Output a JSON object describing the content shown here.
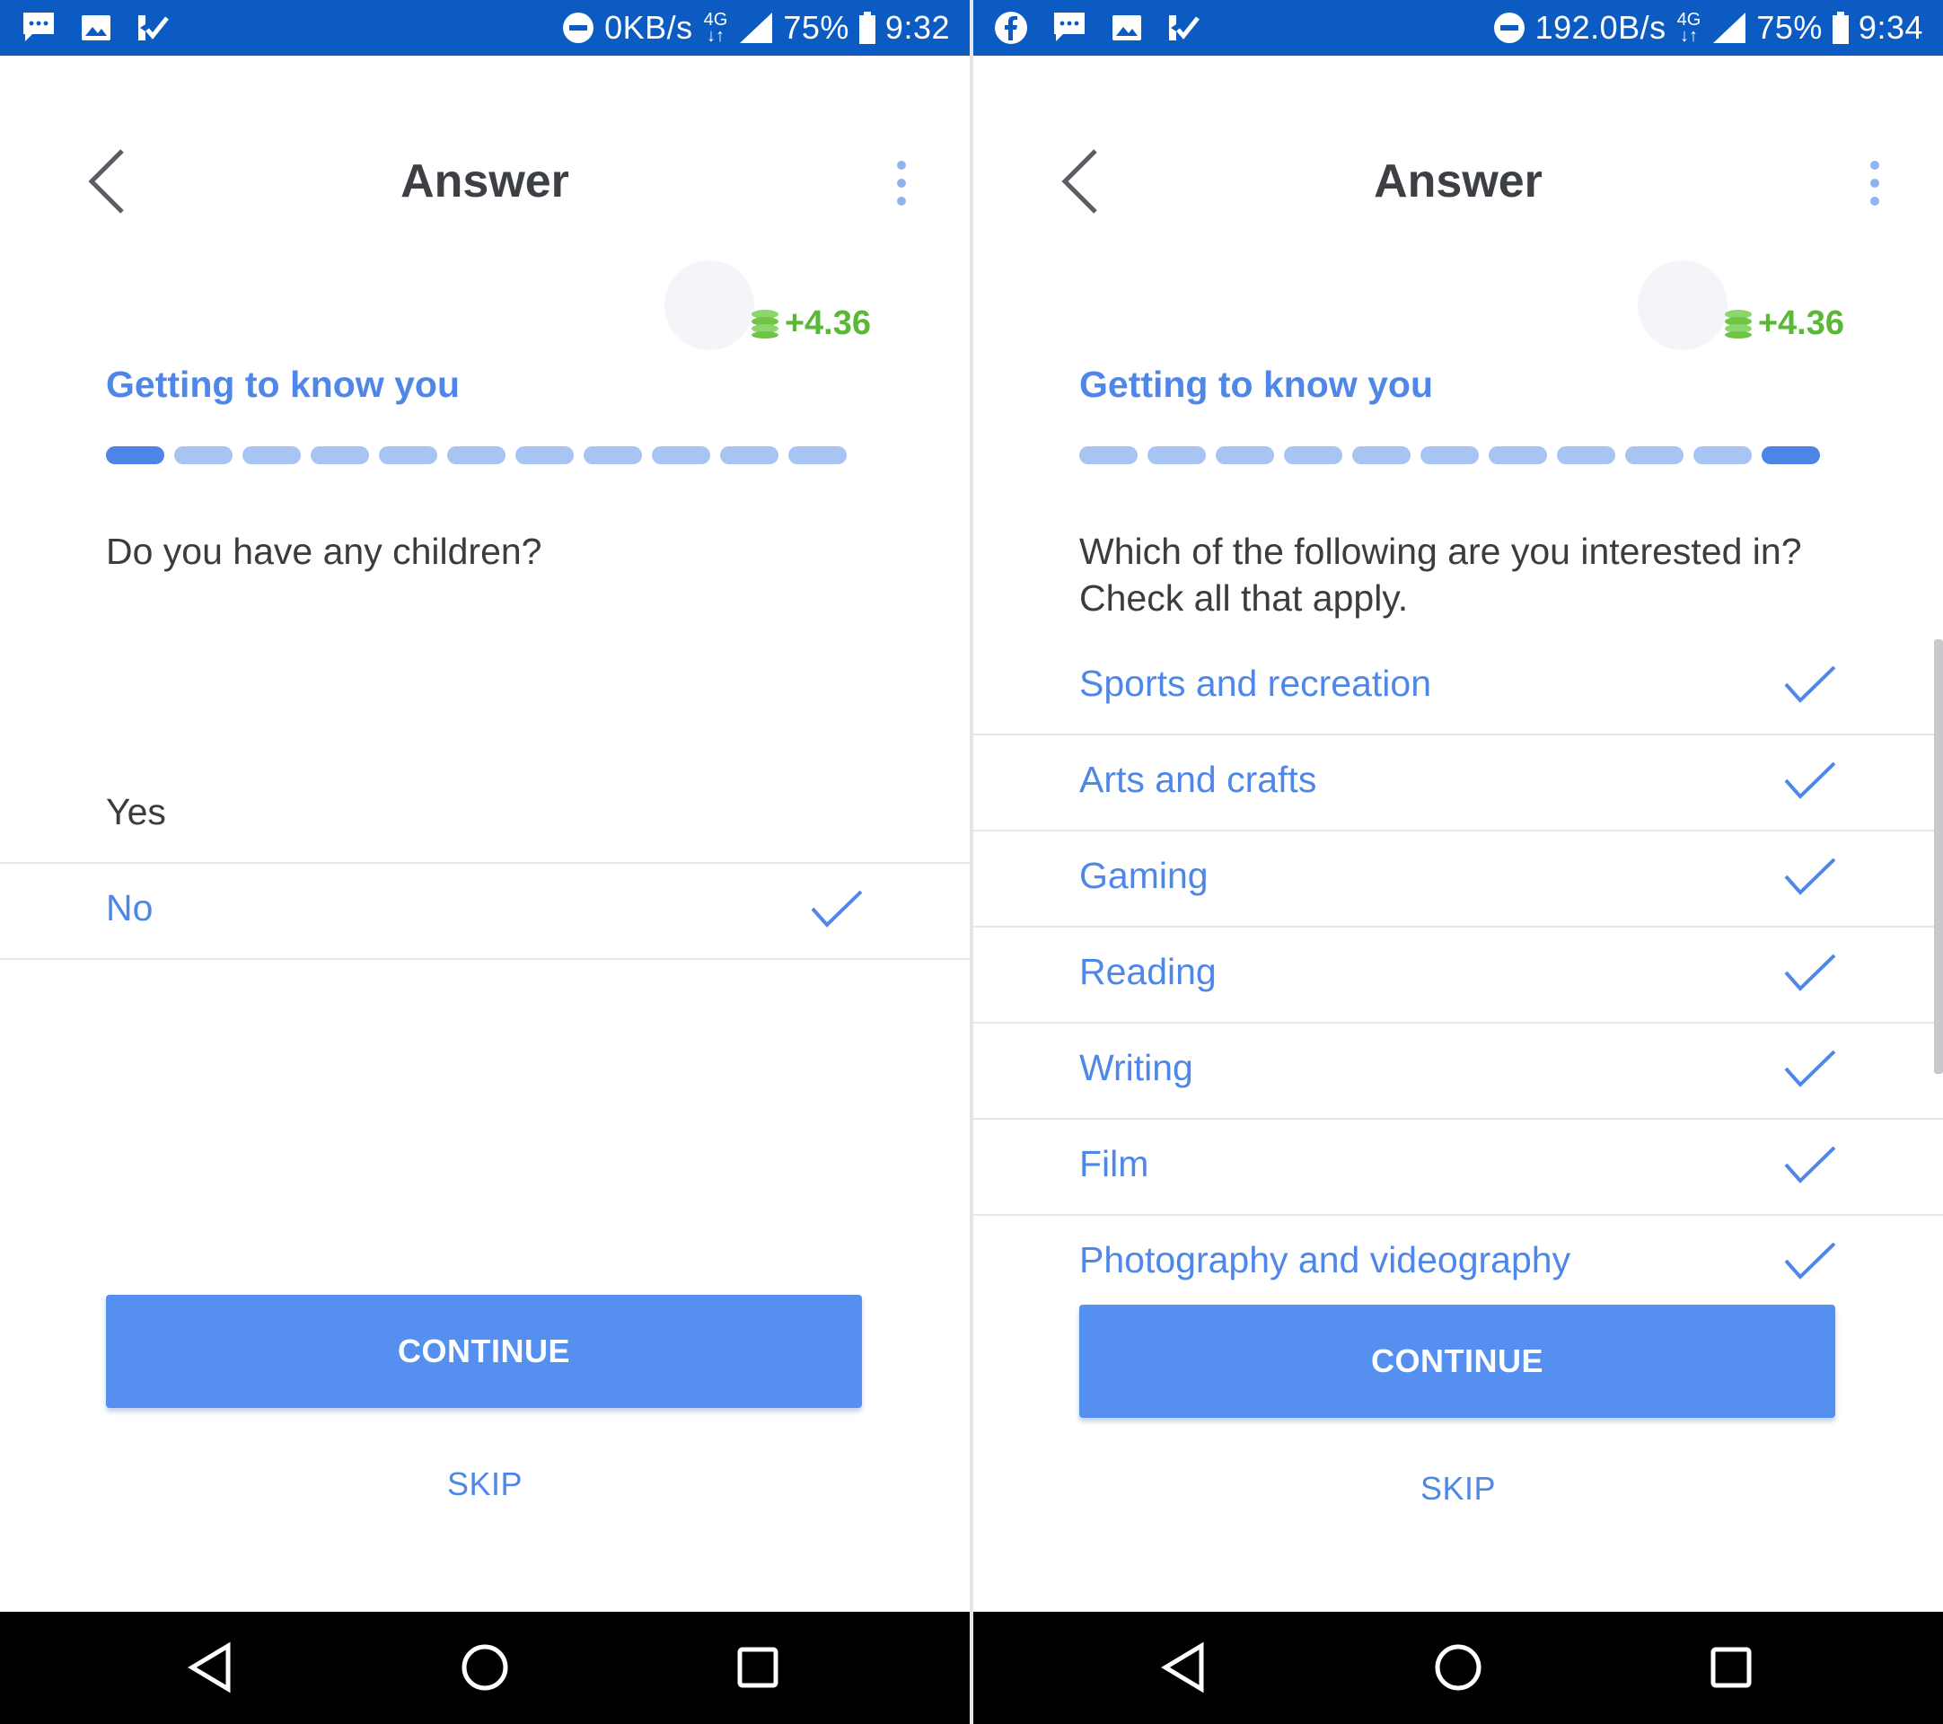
{
  "left": {
    "status": {
      "speed": "0KB/s",
      "network": "4G",
      "battery": "75%",
      "time": "9:32",
      "icons": [
        "message-icon",
        "image-icon",
        "ticket-check-icon"
      ]
    },
    "title": "Answer",
    "reward": "+4.36",
    "section": "Getting to know you",
    "progress": {
      "total": 11,
      "current": 1
    },
    "question": "Do you have any children?",
    "options": [
      {
        "label": "Yes",
        "selected": false
      },
      {
        "label": "No",
        "selected": true
      }
    ],
    "continue_label": "CONTINUE",
    "skip_label": "SKIP"
  },
  "right": {
    "status": {
      "speed": "192.0B/s",
      "network": "4G",
      "battery": "75%",
      "time": "9:34",
      "icons": [
        "facebook-icon",
        "message-icon",
        "image-icon",
        "ticket-check-icon"
      ]
    },
    "title": "Answer",
    "reward": "+4.36",
    "section": "Getting to know you",
    "progress": {
      "total": 11,
      "current": 11
    },
    "question_line1": "Which of the following are you interested in?",
    "question_line2": "Check all that apply.",
    "options": [
      {
        "label": "Sports and recreation",
        "selected": true
      },
      {
        "label": "Arts and crafts",
        "selected": true
      },
      {
        "label": "Gaming",
        "selected": true
      },
      {
        "label": "Reading",
        "selected": true
      },
      {
        "label": "Writing",
        "selected": true
      },
      {
        "label": "Film",
        "selected": true
      },
      {
        "label": "Photography and videography",
        "selected": true
      }
    ],
    "continue_label": "CONTINUE",
    "skip_label": "SKIP"
  },
  "colors": {
    "status_bar": "#0b5bc2",
    "accent": "#4f87e8",
    "button": "#5590f0",
    "reward_green": "#59b934",
    "progress_active": "#4d84e6",
    "progress_inactive": "#a8c4f3"
  }
}
